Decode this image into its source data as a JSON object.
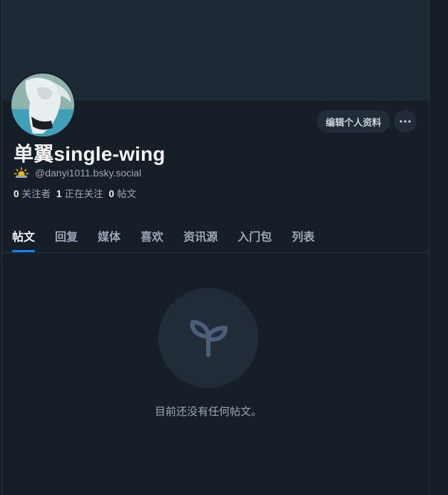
{
  "profile": {
    "display_name": "单翼single-wing",
    "handle": "@danyi1011.bsky.social",
    "followers_count": "0",
    "followers_label": "关注者",
    "following_count": "1",
    "following_label": "正在关注",
    "posts_count": "0",
    "posts_label": "帖文"
  },
  "actions": {
    "edit_profile_label": "编辑个人资料"
  },
  "tabs": [
    {
      "label": "帖文",
      "active": true
    },
    {
      "label": "回复",
      "active": false
    },
    {
      "label": "媒体",
      "active": false
    },
    {
      "label": "喜欢",
      "active": false
    },
    {
      "label": "资讯源",
      "active": false
    },
    {
      "label": "入门包",
      "active": false
    },
    {
      "label": "列表",
      "active": false
    }
  ],
  "empty_state": {
    "message": "目前还没有任何帖文。",
    "icon": "sprout-icon"
  },
  "icons": {
    "handle_prefix": "sun-behind-cloud-icon",
    "more": "ellipsis-icon"
  },
  "colors": {
    "background": "#161e27",
    "banner": "#1e2936",
    "accent": "#1083fe",
    "muted_text": "#9aa7b4",
    "button_bg": "#222c38"
  }
}
